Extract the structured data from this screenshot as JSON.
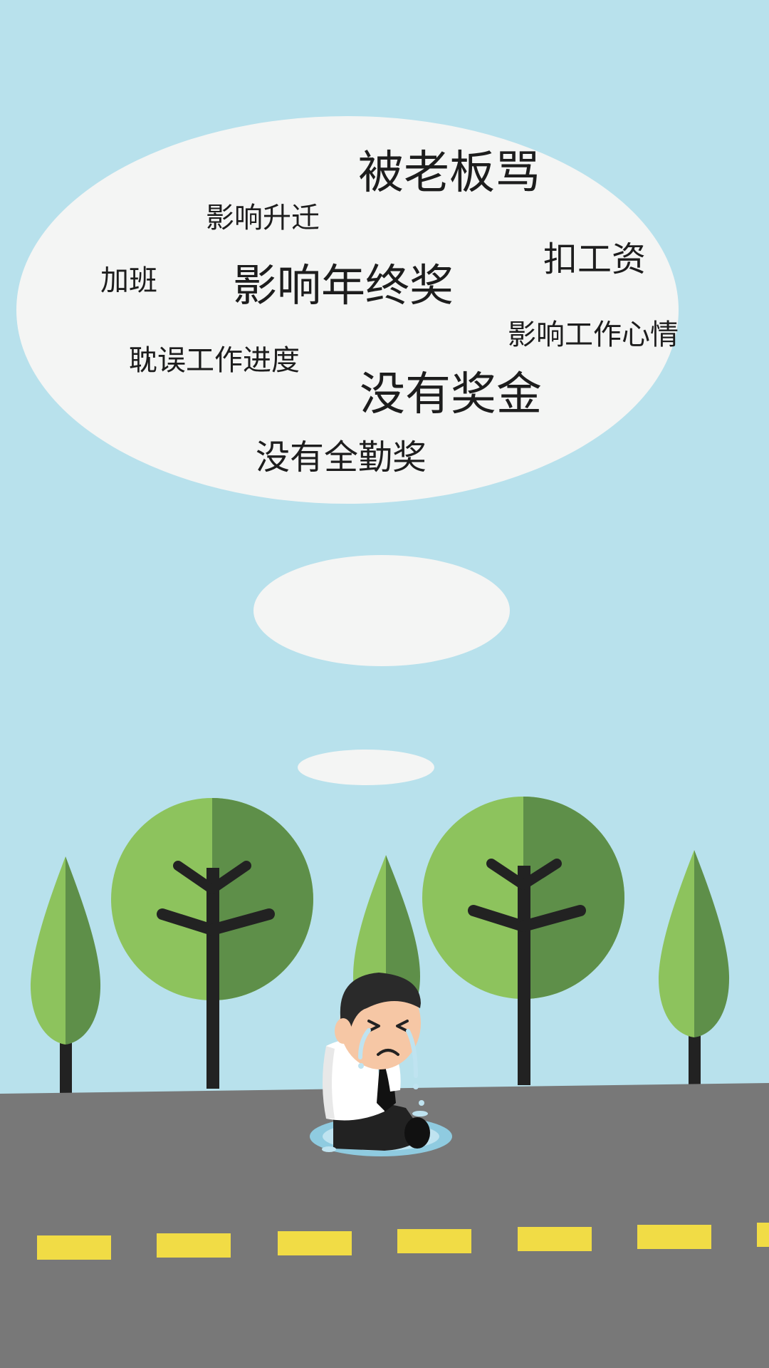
{
  "thought_bubble": {
    "words": [
      "被老板骂",
      "影响升迁",
      "扣工资",
      "加班",
      "影响年终奖",
      "影响工作心情",
      "耽误工作进度",
      "没有奖金",
      "没有全勤奖"
    ]
  },
  "colors": {
    "sky": "#b8e1ec",
    "bubble": "#f4f5f4",
    "road": "#787878",
    "lane_marking": "#f1dc45",
    "tree_light": "#8dc35d",
    "tree_dark": "#5e8f49",
    "trunk": "#222222",
    "shirt": "#ffffff",
    "hair": "#2a2a2a",
    "skin": "#f6c7a5",
    "tears": "#bfe3f0"
  },
  "icons": [
    "thought-bubble-icon",
    "tree-icon",
    "crying-businessman-icon"
  ]
}
